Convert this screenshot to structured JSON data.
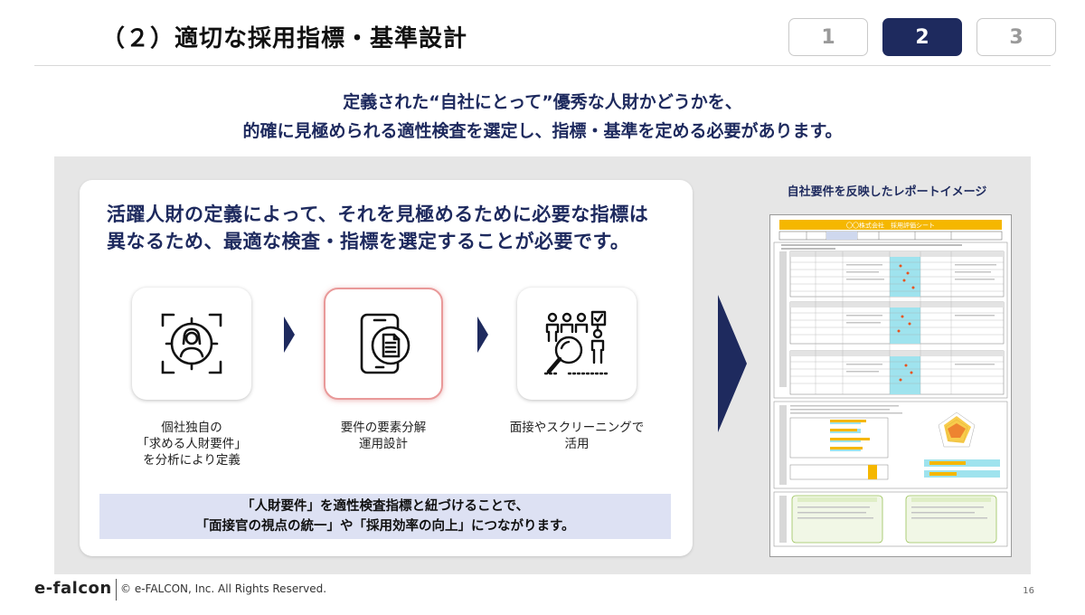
{
  "header": {
    "title": "（２）適切な採用指標・基準設計",
    "steps": [
      {
        "label": "1",
        "active": false
      },
      {
        "label": "2",
        "active": true
      },
      {
        "label": "3",
        "active": false
      }
    ]
  },
  "lead": {
    "line1": "定義された“自社にとって”優秀な人財かどうかを、",
    "line2": "的確に見極められる適性検査を選定し、指標・基準を定める必要があります。"
  },
  "card": {
    "heading_line1": "活躍人財の定義によって、それを見極めるために必要な指標は",
    "heading_line2": "異なるため、最適な検査・指標を選定することが必要です。",
    "flow": [
      {
        "icon": "target-person-icon",
        "caption": [
          "個社独自の",
          "「求める人財要件」",
          "を分析により定義"
        ]
      },
      {
        "icon": "phone-document-icon",
        "caption": [
          "要件の要素分解",
          "運用設計"
        ]
      },
      {
        "icon": "screening-magnifier-icon",
        "caption": [
          "面接やスクリーニングで",
          "活用"
        ]
      }
    ],
    "note_line1": "「人財要件」を適性検査指標と紐づけることで、",
    "note_line2": "「面接官の視点の統一」や「採用効率の向上」につながります。"
  },
  "report": {
    "title": "自社要件を反映したレポートイメージ",
    "sheet_title": "〇〇株式会社　採用評価シート"
  },
  "footer": {
    "logo": "e-falcon",
    "copyright": "© e-FALCON, Inc. All Rights Reserved.",
    "page": "16"
  },
  "colors": {
    "navy": "#1e2a5e",
    "highlight_border": "#e99999",
    "note_bg": "#dde1f3",
    "panel_bg": "#e6e6e6",
    "report_header": "#f5b700",
    "report_cyan": "#9fe3ee",
    "report_marker": "#e8541e"
  }
}
